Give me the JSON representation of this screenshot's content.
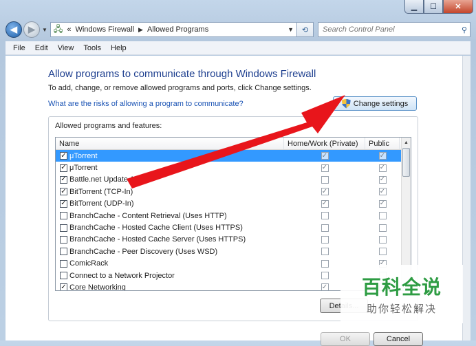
{
  "address": {
    "overflow": "«",
    "crumbs": [
      "Windows Firewall",
      "Allowed Programs"
    ]
  },
  "search": {
    "placeholder": "Search Control Panel"
  },
  "menu": [
    "File",
    "Edit",
    "View",
    "Tools",
    "Help"
  ],
  "page": {
    "title": "Allow programs to communicate through Windows Firewall",
    "subtitle": "To add, change, or remove allowed programs and ports, click Change settings.",
    "risk_link": "What are the risks of allowing a program to communicate?",
    "change_settings": "Change settings"
  },
  "group_label": "Allowed programs and features:",
  "columns": {
    "name": "Name",
    "private": "Home/Work (Private)",
    "public": "Public"
  },
  "programs": [
    {
      "name": "μTorrent",
      "enabled": true,
      "private": true,
      "public": true,
      "selected": true
    },
    {
      "name": "μTorrent",
      "enabled": true,
      "private": true,
      "public": true
    },
    {
      "name": "Battle.net Update Agent",
      "enabled": true,
      "private": false,
      "public": true
    },
    {
      "name": "BitTorrent (TCP-In)",
      "enabled": true,
      "private": true,
      "public": true
    },
    {
      "name": "BitTorrent (UDP-In)",
      "enabled": true,
      "private": true,
      "public": true
    },
    {
      "name": "BranchCache - Content Retrieval (Uses HTTP)",
      "enabled": false,
      "private": false,
      "public": false
    },
    {
      "name": "BranchCache - Hosted Cache Client (Uses HTTPS)",
      "enabled": false,
      "private": false,
      "public": false
    },
    {
      "name": "BranchCache - Hosted Cache Server (Uses HTTPS)",
      "enabled": false,
      "private": false,
      "public": false
    },
    {
      "name": "BranchCache - Peer Discovery (Uses WSD)",
      "enabled": false,
      "private": false,
      "public": false
    },
    {
      "name": "ComicRack",
      "enabled": false,
      "private": false,
      "public": true
    },
    {
      "name": "Connect to a Network Projector",
      "enabled": false,
      "private": false,
      "public": false
    },
    {
      "name": "Core Networking",
      "enabled": true,
      "private": true,
      "public": true
    }
  ],
  "buttons": {
    "details": "Details...",
    "ok": "OK",
    "cancel": "Cancel"
  },
  "watermark": {
    "title": "百科全说",
    "subtitle": "助你轻松解决"
  },
  "colors": {
    "arrow": "#e8151b",
    "selection": "#3399ff",
    "title": "#1e3f8f",
    "link": "#1a53b4"
  }
}
